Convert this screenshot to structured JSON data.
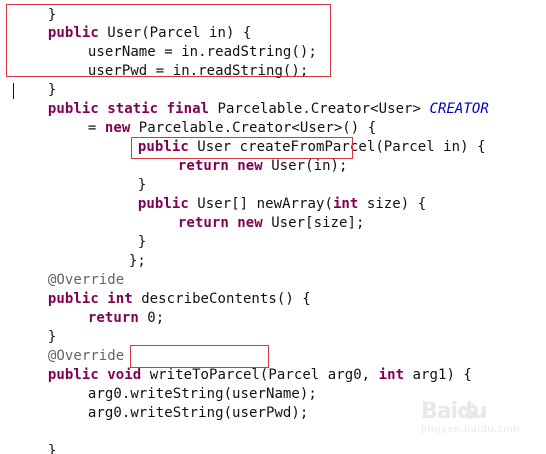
{
  "code": {
    "lines": [
      "}",
      "public User(Parcel in) {",
      "userName = in.readString();",
      "userPwd = in.readString();",
      "}",
      "public static final Parcelable.Creator<User> CREATOR",
      "= new Parcelable.Creator<User>() {",
      "public User createFromParcel(Parcel in) {",
      "return new User(in);",
      "}",
      "public User[] newArray(int size) {",
      "return new User[size];",
      "}",
      "};",
      "@Override",
      "public int describeContents() {",
      "return 0;",
      "}",
      "@Override",
      "public void writeToParcel(Parcel arg0, int arg1) {",
      "arg0.writeString(userName);",
      "arg0.writeString(userPwd);",
      "}"
    ]
  },
  "tokens": {
    "public": "public",
    "static": "static",
    "final": "final",
    "new": "new",
    "return": "return",
    "int": "int",
    "void": "void",
    "override": "@Override",
    "creator": "CREATOR",
    "close_brace": "}",
    "close_brace_semicolon": "};"
  },
  "fragments": {
    "constructor_sig": " User(Parcel in) {",
    "user_name_assign": "userName = in.readString();",
    "user_pwd_assign": "userPwd = in.readString();",
    "creator_type": " Parcelable.Creator<User> ",
    "creator_init": " Parcelable.Creator<User>() {",
    "equals": "= ",
    "create_sig": " User createFromParcel(Parcel in) {",
    "new_user_in": " User(in);",
    "new_array_sig_a": " User[] newArray(",
    "new_array_sig_b": " size) {",
    "new_user_size": " User[size];",
    "describe_sig": " describeContents() {",
    "return_zero": " 0;",
    "write_sig_a": "writeToParcel",
    "write_sig_b": "(Parcel arg0, ",
    "write_sig_c": " arg1) {",
    "write_name": "arg0.writeString(userName);",
    "write_pwd": "arg0.writeString(userPwd);"
  },
  "highlights": [
    "User(Parcel in) constructor",
    "return new User(in);",
    "writeToParcel"
  ],
  "watermark": {
    "brand": "Baidu",
    "sub": "jingyan.baidu.com"
  },
  "colors": {
    "keyword": "#7f0055",
    "annotation": "#646464",
    "constant": "#0000c0",
    "highlight_box": "#d9363e",
    "text": "#111111",
    "background": "#ffffff"
  }
}
